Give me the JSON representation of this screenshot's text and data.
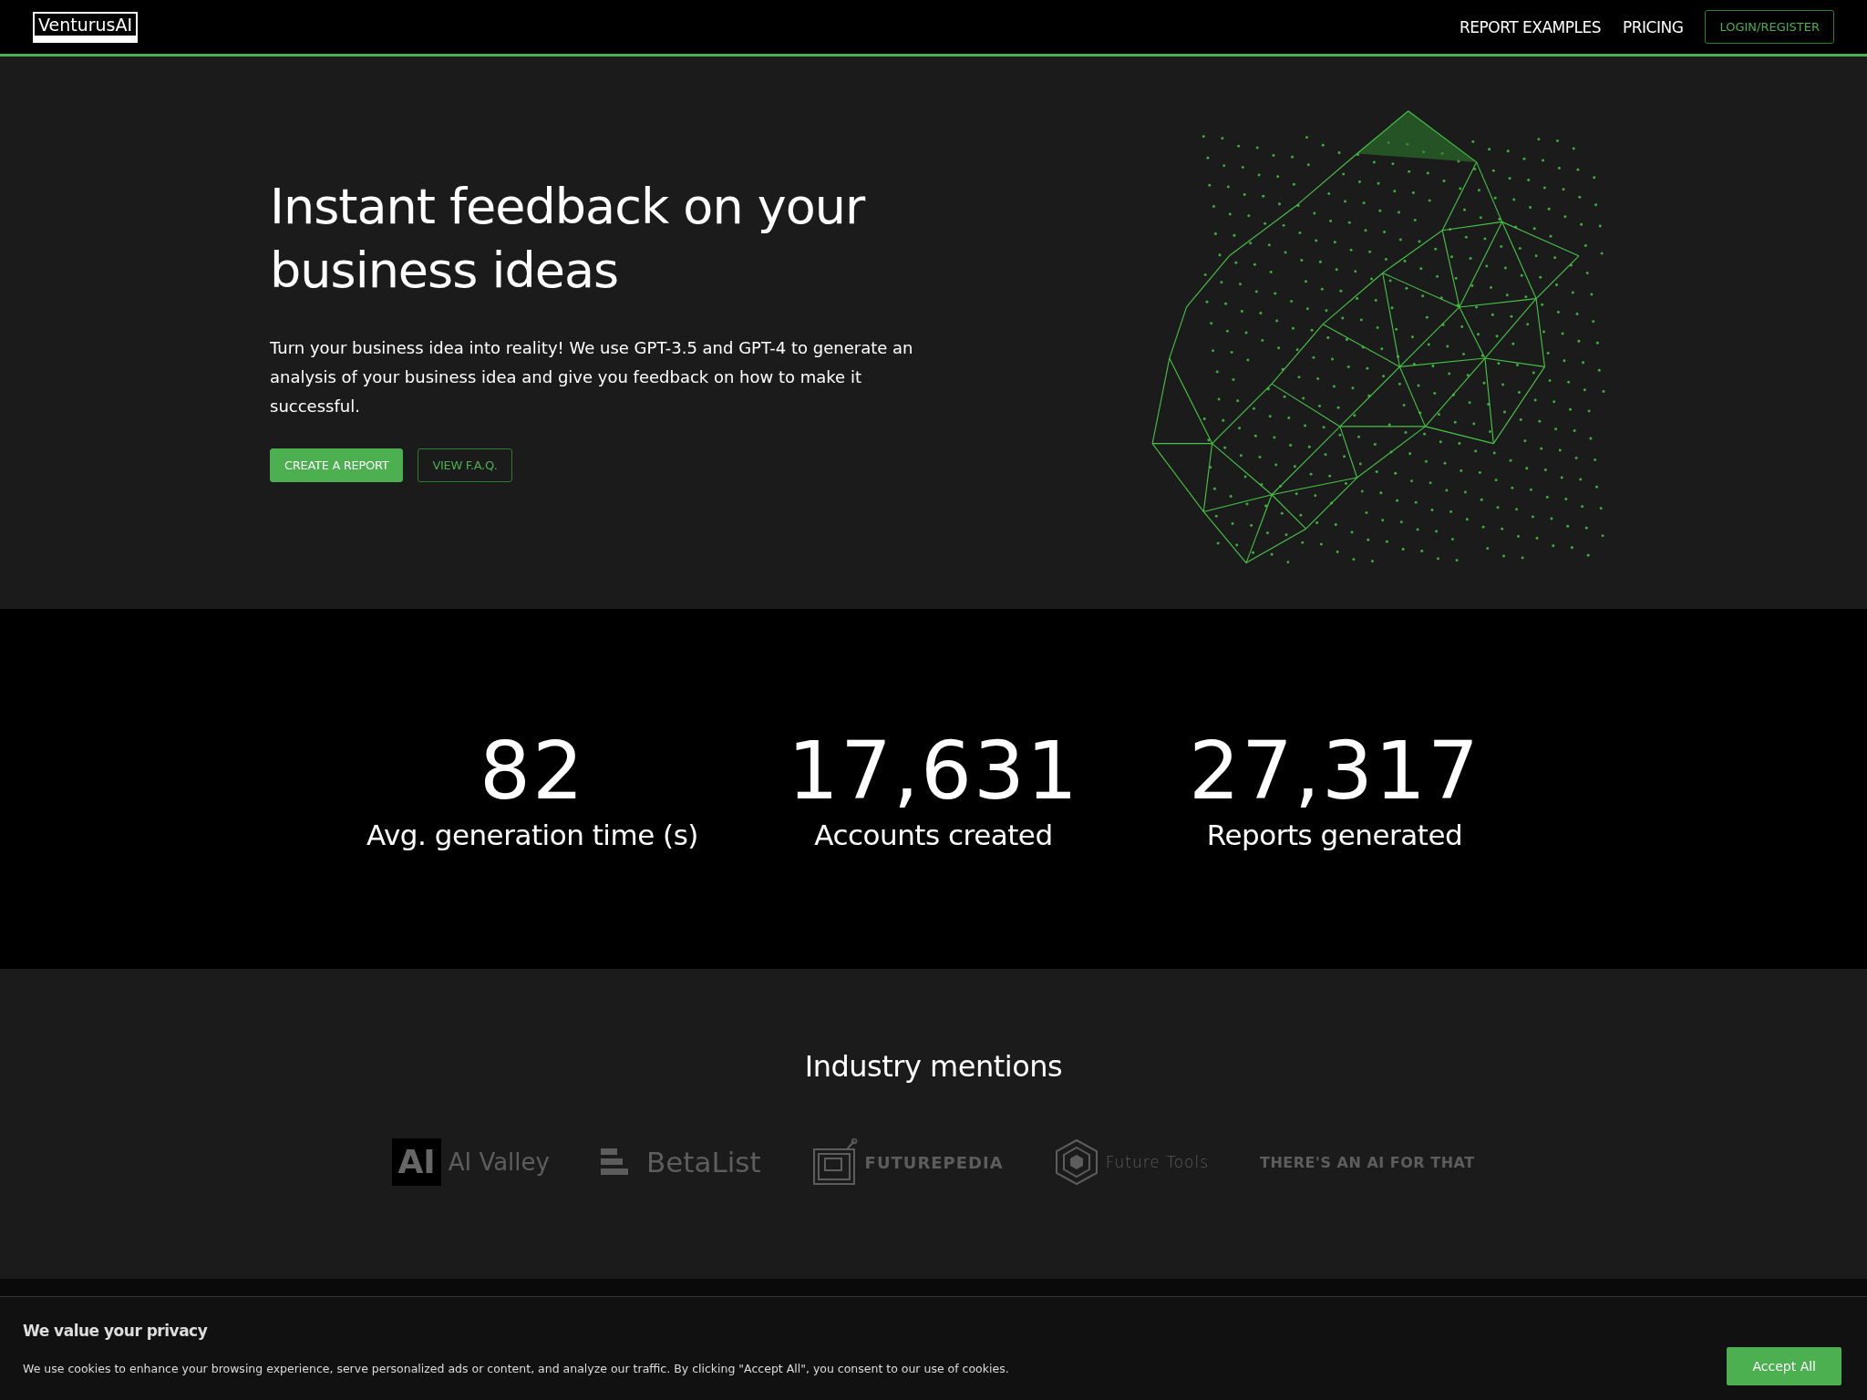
{
  "header": {
    "logo": "VenturusAI",
    "nav": [
      "REPORT EXAMPLES",
      "PRICING"
    ],
    "login": "LOGIN/REGISTER"
  },
  "hero": {
    "title": "Instant feedback on your business ideas",
    "text": "Turn your business idea into reality! We use GPT-3.5 and GPT-4 to generate an analysis of your business idea and give you feedback on how to make it successful.",
    "buttons": [
      {
        "label": "CREATE A REPORT",
        "kind": "primary"
      },
      {
        "label": "VIEW F.A.Q.",
        "kind": "outline"
      }
    ]
  },
  "stats": [
    {
      "value": "82",
      "label": "Avg. generation time (s)"
    },
    {
      "value": "17,631",
      "label": "Accounts created"
    },
    {
      "value": "27,317",
      "label": "Reports generated"
    }
  ],
  "mentions": {
    "title": "Industry mentions",
    "logos": [
      {
        "kind": "aivalley",
        "mark": "AI",
        "name": "AI Valley"
      },
      {
        "kind": "betalist",
        "name": "BetaList"
      },
      {
        "kind": "futurepedia",
        "name": "FUTUREPEDIA"
      },
      {
        "kind": "futuretools",
        "name": "Future Tools"
      },
      {
        "kind": "taaft",
        "name": "THERE'S AN AI FOR THAT"
      }
    ]
  },
  "cookie": {
    "title": "We value your privacy",
    "text": "We use cookies to enhance your browsing experience, serve personalized ads or content, and analyze our traffic. By clicking \"Accept All\", you consent to our use of cookies.",
    "button": "Accept All"
  }
}
